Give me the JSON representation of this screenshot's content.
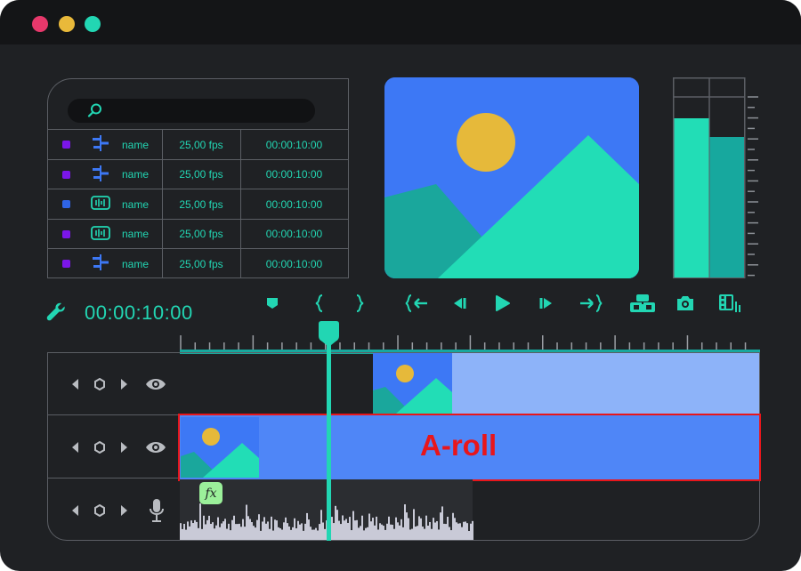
{
  "window": {
    "controls": [
      "close",
      "minimize",
      "maximize"
    ]
  },
  "media_browser": {
    "search": {
      "placeholder": "",
      "icon": "search-icon"
    },
    "rows": [
      {
        "color": "#7b16e8",
        "icon": "video-adjust-icon",
        "name": "name",
        "fps": "25,00 fps",
        "duration": "00:00:10:00"
      },
      {
        "color": "#7b16e8",
        "icon": "video-adjust-icon",
        "name": "name",
        "fps": "25,00 fps",
        "duration": "00:00:10:00"
      },
      {
        "color": "#2f64e6",
        "icon": "audio-wave-icon",
        "name": "name",
        "fps": "25,00 fps",
        "duration": "00:00:10:00"
      },
      {
        "color": "#7b16e8",
        "icon": "audio-wave-icon",
        "name": "name",
        "fps": "25,00 fps",
        "duration": "00:00:10:00"
      },
      {
        "color": "#7b16e8",
        "icon": "video-adjust-icon",
        "name": "name",
        "fps": "25,00 fps",
        "duration": "00:00:10:00"
      }
    ]
  },
  "toolbar": {
    "timecode": "00:00:10:00",
    "buttons": [
      "marker-icon",
      "mark-in-icon",
      "mark-out-icon",
      "go-to-in-icon",
      "step-back-icon",
      "play-icon",
      "step-forward-icon",
      "go-to-out-icon",
      "camera-switch-icon",
      "snapshot-icon",
      "film-settings-icon"
    ]
  },
  "timeline": {
    "tracks": [
      {
        "type": "video",
        "visible_icon": "eye-icon"
      },
      {
        "type": "video",
        "visible_icon": "eye-icon",
        "clip_label": "A-roll"
      },
      {
        "type": "audio",
        "visible_icon": "microphone-icon",
        "effect_badge": "fx"
      }
    ]
  },
  "colors": {
    "accent": "#22d6b3",
    "clip_blue": "#4f86f7",
    "clip_light": "#8db3f9",
    "highlight": "#e8161b"
  }
}
